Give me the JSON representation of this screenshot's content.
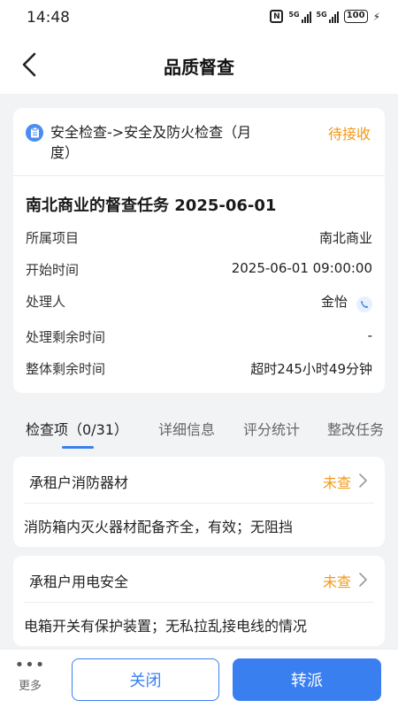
{
  "status_bar": {
    "time": "14:48",
    "signal1": "5G",
    "signal2": "5G",
    "battery": "100"
  },
  "nav": {
    "title": "品质督查"
  },
  "task": {
    "path": "安全检查->安全及防火检查（月度）",
    "status": "待接收",
    "title": "南北商业的督查任务 2025-06-01",
    "fields": [
      {
        "label": "所属项目",
        "value": "南北商业"
      },
      {
        "label": "开始时间",
        "value": "2025-06-01 09:00:00"
      },
      {
        "label": "处理人",
        "value": "金怡"
      },
      {
        "label": "处理剩余时间",
        "value": "-"
      },
      {
        "label": "整体剩余时间",
        "value": "超时245小时49分钟"
      }
    ]
  },
  "tabs": [
    {
      "label": "检查项（0/31）",
      "active": true
    },
    {
      "label": "详细信息",
      "active": false
    },
    {
      "label": "评分统计",
      "active": false
    },
    {
      "label": "整改任务",
      "active": false
    }
  ],
  "check_items": [
    {
      "name": "承租户消防器材",
      "status": "未查",
      "description": "消防箱内灭火器材配备齐全，有效；无阻挡"
    },
    {
      "name": "承租户用电安全",
      "status": "未查",
      "description": "电箱开关有保护装置；无私拉乱接电线的情况"
    }
  ],
  "bottom": {
    "more_label": "更多",
    "close_label": "关闭",
    "transfer_label": "转派"
  },
  "colors": {
    "accent": "#3a7ff0",
    "pending": "#f29a1a"
  }
}
